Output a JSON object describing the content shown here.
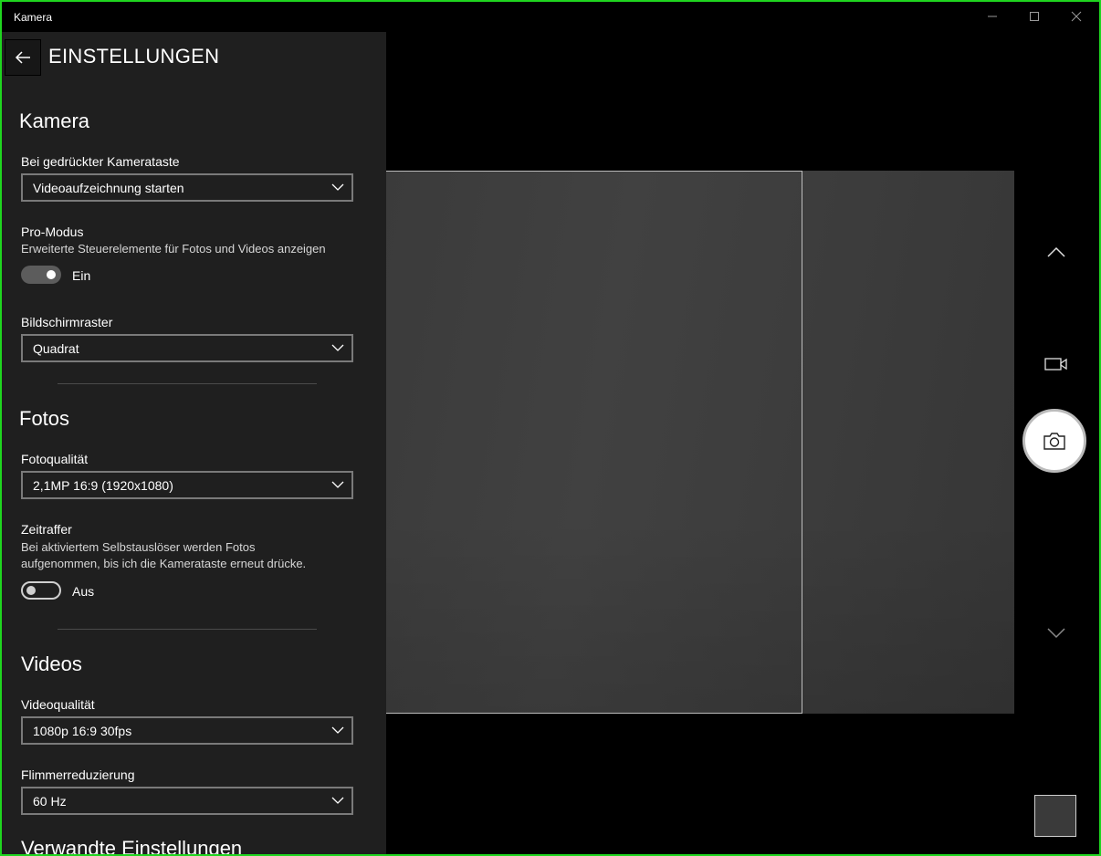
{
  "window": {
    "title": "Kamera",
    "minimize_glyph": "—",
    "maximize_glyph": "☐",
    "close_glyph": "✕"
  },
  "settings": {
    "back_glyph": "←",
    "title": "EINSTELLUNGEN",
    "kamera": {
      "heading": "Kamera",
      "button_label": "Bei gedrückter Kamerataste",
      "button_value": "Videoaufzeichnung starten",
      "pro_label": "Pro-Modus",
      "pro_desc": "Erweiterte Steuerelemente für Fotos und Videos anzeigen",
      "pro_state": "Ein",
      "grid_label": "Bildschirmraster",
      "grid_value": "Quadrat"
    },
    "fotos": {
      "heading": "Fotos",
      "quality_label": "Fotoqualität",
      "quality_value": "2,1MP 16:9 (1920x1080)",
      "timelapse_label": "Zeitraffer",
      "timelapse_desc_1": "Bei aktiviertem Selbstauslöser werden Fotos",
      "timelapse_desc_2": "aufgenommen, bis ich die Kamerataste erneut drücke.",
      "timelapse_state": "Aus"
    },
    "videos": {
      "heading": "Videos",
      "quality_label": "Videoqualität",
      "quality_value": "1080p 16:9 30fps",
      "flicker_label": "Flimmerreduzierung",
      "flicker_value": "60 Hz"
    },
    "related_heading": "Verwandte Einstellungen"
  },
  "icons": {
    "back": "arrow-left-icon",
    "dropdown": "chevron-down-icon",
    "scroll_up": "chevron-up-icon",
    "scroll_down": "chevron-down-icon",
    "video_mode": "video-camera-icon",
    "shutter": "camera-icon"
  },
  "colors": {
    "panel_bg": "#1f1f1f",
    "window_border": "#1fd51f",
    "viewfinder": "#3d3d3d"
  }
}
